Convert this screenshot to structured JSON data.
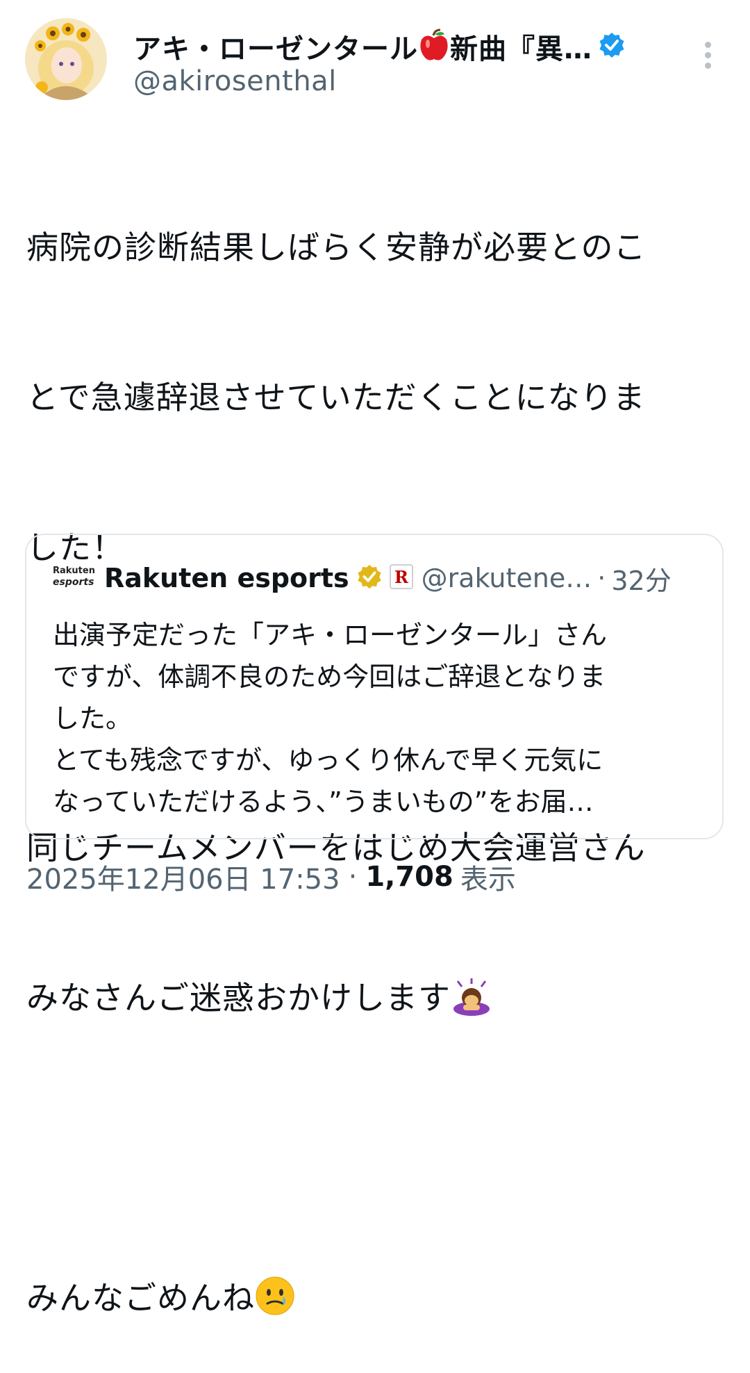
{
  "author": {
    "display_name": "アキ・ローゼンタール",
    "display_name_suffix": "新曲『異…",
    "handle": "@akirosenthal",
    "verified_color": "#1d9bf0"
  },
  "tweet": {
    "lines": [
      "病院の診断結果しばらく安静が必要とのこ",
      "とで急遽辞退させていただくことになりま",
      "した！",
      "",
      "同じチームメンバーをはじめ大会運営さん",
      "みなさんご迷惑おかけします",
      "",
      "みんなごめんね"
    ]
  },
  "quote": {
    "logo_line1": "Rakuten",
    "logo_line2": "esports",
    "name": "Rakuten esports",
    "handle": "@rakutene…",
    "dot": "·",
    "time": "32分",
    "lines": [
      "出演予定だった「アキ・ローゼンタール」さん",
      "ですが、体調不良のため今回はご辞退となりま",
      "した。",
      "とても残念ですが、ゆっくり休んで早く元気に",
      "なっていただけるよう、”うまいもの”をお届…"
    ],
    "badge_color": "#e2b719"
  },
  "meta": {
    "datetime": "2025年12月06日 17:53",
    "sep": "·",
    "views_count": "1,708",
    "views_label": "表示"
  },
  "icons": [
    "avatar",
    "apple-icon",
    "verified-badge-icon",
    "more-icon",
    "bowing-person-icon",
    "crying-face-icon",
    "gold-badge-icon",
    "rakuten-r-icon"
  ]
}
